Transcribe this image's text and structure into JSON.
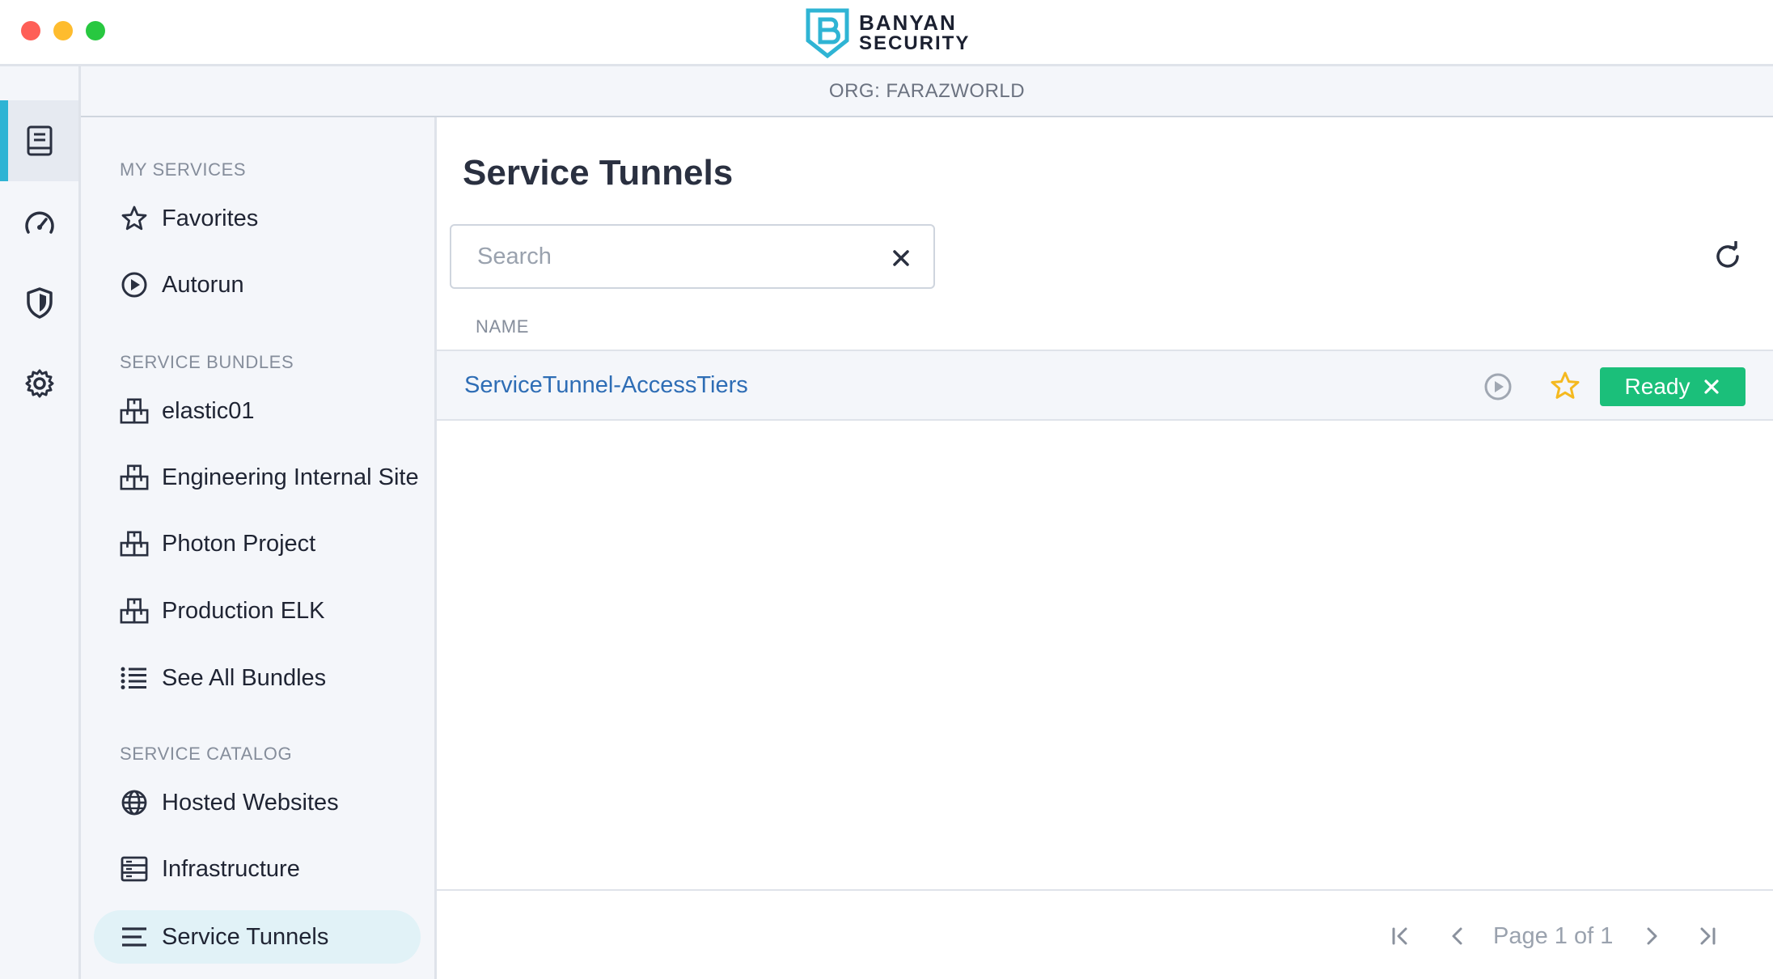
{
  "window": {
    "brand": {
      "line1": "BANYAN",
      "line2": "SECURITY"
    }
  },
  "rail": {
    "items": [
      {
        "icon": "book-icon",
        "active": true
      },
      {
        "icon": "gauge-icon",
        "active": false
      },
      {
        "icon": "shield-icon",
        "active": false
      },
      {
        "icon": "gear-icon",
        "active": false
      }
    ]
  },
  "org": {
    "label": "ORG: FARAZWORLD"
  },
  "sidebar": {
    "my_services": {
      "title": "MY SERVICES",
      "items": [
        {
          "label": "Favorites",
          "icon": "star-icon"
        },
        {
          "label": "Autorun",
          "icon": "play-circle-icon"
        }
      ]
    },
    "service_bundles": {
      "title": "SERVICE BUNDLES",
      "items": [
        {
          "label": "elastic01",
          "icon": "bundle-icon"
        },
        {
          "label": "Engineering Internal Site",
          "icon": "bundle-icon"
        },
        {
          "label": "Photon Project",
          "icon": "bundle-icon"
        },
        {
          "label": "Production ELK",
          "icon": "bundle-icon"
        },
        {
          "label": "See All Bundles",
          "icon": "list-icon"
        }
      ]
    },
    "service_catalog": {
      "title": "SERVICE CATALOG",
      "items": [
        {
          "label": "Hosted Websites",
          "icon": "globe-icon"
        },
        {
          "label": "Infrastructure",
          "icon": "server-icon"
        },
        {
          "label": "Service Tunnels",
          "icon": "lines-icon",
          "active": true
        }
      ]
    }
  },
  "main": {
    "title": "Service Tunnels",
    "search": {
      "placeholder": "Search",
      "value": ""
    },
    "table": {
      "columns": [
        "NAME"
      ],
      "rows": [
        {
          "name": "ServiceTunnel-AccessTiers",
          "status": "Ready"
        }
      ]
    },
    "pagination": {
      "label": "Page 1 of 1"
    }
  },
  "colors": {
    "accent": "#2fb4d4",
    "link": "#2e6db5",
    "ready": "#1bbf7a",
    "star": "#f5b91f"
  }
}
